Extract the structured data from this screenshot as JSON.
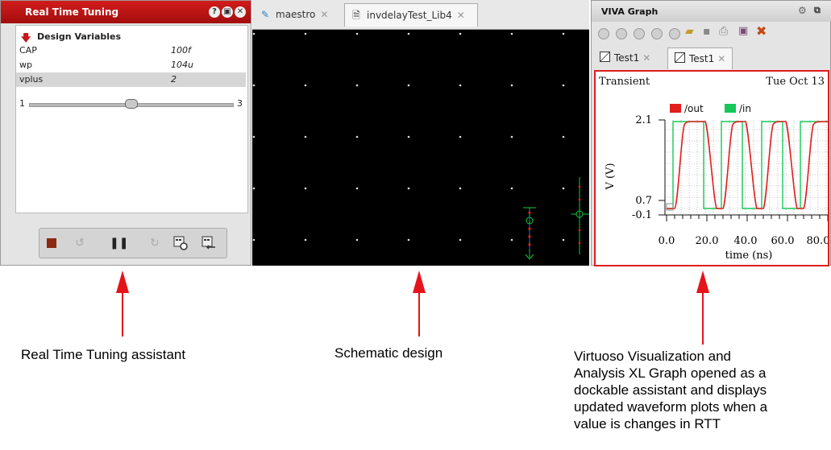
{
  "rtt": {
    "title": "Real Time Tuning",
    "header": "Design Variables",
    "variables": [
      {
        "name": "CAP",
        "value": "100f"
      },
      {
        "name": "wp",
        "value": "104u"
      },
      {
        "name": "vplus",
        "value": "2"
      }
    ],
    "slider": {
      "min": "1",
      "max": "3",
      "level": 0.5
    }
  },
  "schematic": {
    "tabs": [
      {
        "label": "maestro"
      },
      {
        "label": "invdelayTest_Lib4"
      }
    ]
  },
  "viva": {
    "title": "VIVA Graph",
    "tabs": [
      {
        "label": "Test1"
      },
      {
        "label": "Test1"
      }
    ],
    "plot_title": "Transient",
    "date": "Tue Oct 13",
    "ylabel": "V (V)",
    "xlabel": "time (ns)",
    "legend": [
      "/out",
      "/in"
    ],
    "yticks": [
      "2.1",
      "0.7",
      "-0.1"
    ],
    "xticks": [
      "0.0",
      "20.0",
      "40.0",
      "60.0",
      "80.0"
    ],
    "colors": {
      "out": "#e01e1e",
      "in": "#16c75a"
    }
  },
  "captions": {
    "left": "Real Time Tuning assistant",
    "middle": "Schematic design",
    "right": [
      "Virtuoso Visualization and",
      "Analysis XL Graph opened as a",
      "dockable assistant and displays",
      "updated waveform plots when a",
      "value is changes in RTT"
    ]
  }
}
